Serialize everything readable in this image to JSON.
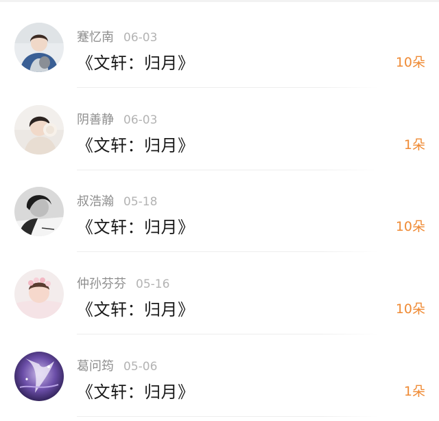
{
  "records": [
    {
      "name": "蹇忆南",
      "date": "06-03",
      "title": "《文轩：归月》",
      "count": "10朵",
      "avatar_icon": "avatar-girl-blue-jacket"
    },
    {
      "name": "阴善静",
      "date": "06-03",
      "title": "《文轩：归月》",
      "count": "1朵",
      "avatar_icon": "avatar-girl-earmuffs"
    },
    {
      "name": "叔浩瀚",
      "date": "05-18",
      "title": "《文轩：归月》",
      "count": "10朵",
      "avatar_icon": "avatar-man-monochrome"
    },
    {
      "name": "仲孙芬芬",
      "date": "05-16",
      "title": "《文轩：归月》",
      "count": "10朵",
      "avatar_icon": "avatar-child-flower-crown"
    },
    {
      "name": "葛问筠",
      "date": "05-06",
      "title": "《文轩：归月》",
      "count": "1朵",
      "avatar_icon": "avatar-anime-purple"
    }
  ],
  "colors": {
    "count_accent": "#ef8a34",
    "name_gray": "#8e8e8e",
    "date_gray": "#b3b3b3",
    "title_dark": "#1a1a1a"
  }
}
